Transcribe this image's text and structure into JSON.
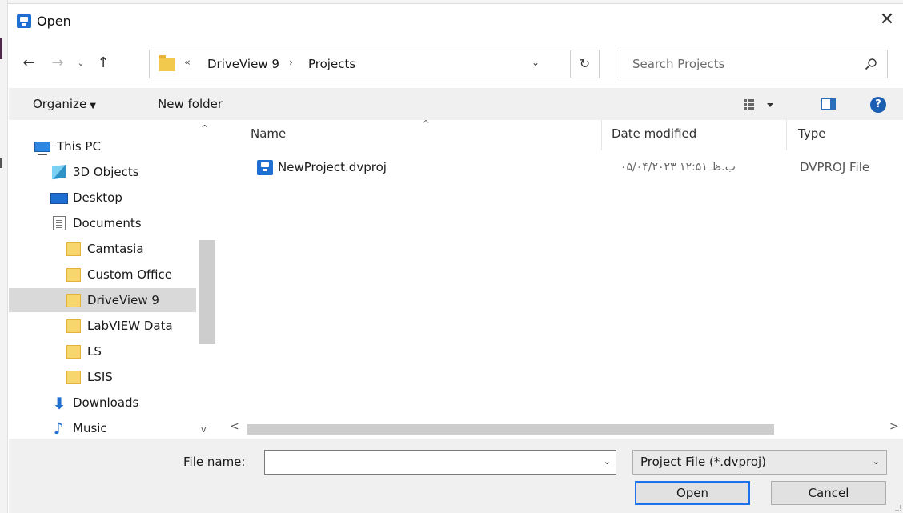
{
  "window": {
    "title": "Open",
    "close_glyph": "✕"
  },
  "nav": {
    "back_glyph": "←",
    "forward_glyph": "→",
    "recent_glyph": "⌄",
    "up_glyph": "↑",
    "refresh_glyph": "↻"
  },
  "address": {
    "overflow_glyph": "«",
    "segments": [
      "DriveView 9",
      "Projects"
    ],
    "separator": "›",
    "dropdown_glyph": "⌄"
  },
  "search": {
    "placeholder": "Search Projects"
  },
  "toolbar": {
    "organize_label": "Organize",
    "organize_caret": "▼",
    "new_folder_label": "New folder",
    "help_label": "?"
  },
  "sidebar": {
    "items": [
      {
        "label": "This PC",
        "icon": "computer-icon"
      },
      {
        "label": "3D Objects",
        "icon": "3d-objects-icon"
      },
      {
        "label": "Desktop",
        "icon": "desktop-icon"
      },
      {
        "label": "Documents",
        "icon": "documents-icon"
      },
      {
        "label": "Camtasia",
        "icon": "folder-icon"
      },
      {
        "label": "Custom Office",
        "icon": "folder-icon"
      },
      {
        "label": "DriveView 9",
        "icon": "folder-icon",
        "selected": true
      },
      {
        "label": "LabVIEW Data",
        "icon": "folder-icon"
      },
      {
        "label": "LS",
        "icon": "folder-icon"
      },
      {
        "label": "LSIS",
        "icon": "folder-icon"
      },
      {
        "label": "Downloads",
        "icon": "download-icon"
      },
      {
        "label": "Music",
        "icon": "music-icon"
      }
    ],
    "scroll_up_glyph": "^",
    "scroll_down_glyph": "v"
  },
  "file_list": {
    "columns": [
      "Name",
      "Date modified",
      "Type"
    ],
    "sort_glyph": "^",
    "rows": [
      {
        "name": "NewProject.dvproj",
        "date_modified": "۰۵/۰۴/۲۰۲۳ ب.ظ ۱۲:۵۱",
        "type": "DVPROJ File"
      }
    ],
    "hscroll_left_glyph": "<",
    "hscroll_right_glyph": ">"
  },
  "footer": {
    "file_name_label": "File name:",
    "file_name_value": "",
    "filter_value": "Project File (*.dvproj)",
    "open_label": "Open",
    "cancel_label": "Cancel",
    "dropdown_glyph": "⌄"
  },
  "colors": {
    "accent": "#1a73e8",
    "selected_bg": "#d9d9d9",
    "bar_bg": "#f0f0f0"
  }
}
